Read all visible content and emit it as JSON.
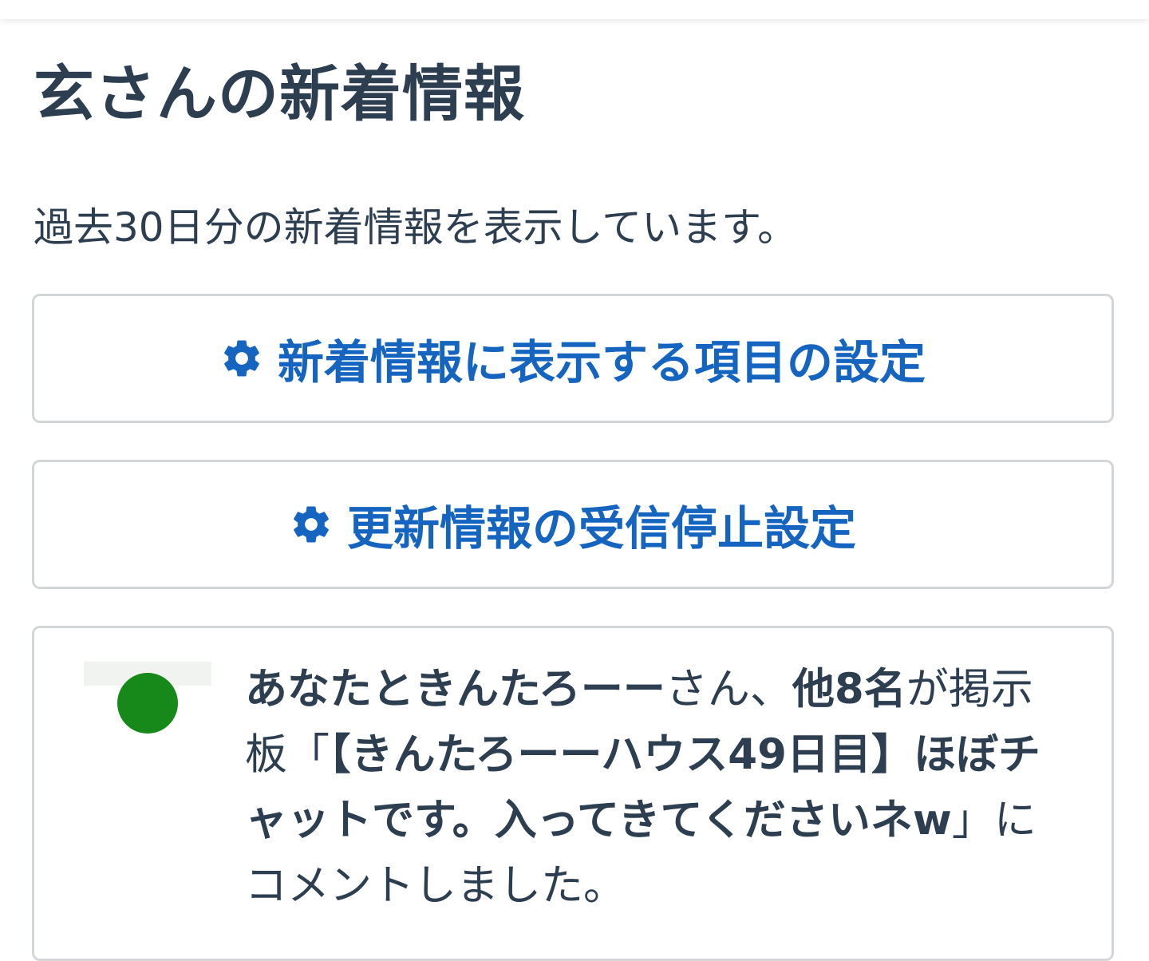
{
  "page": {
    "title": "玄さんの新着情報",
    "description": "過去30日分の新着情報を表示しています。"
  },
  "buttons": {
    "display_settings": {
      "icon": "gear-icon",
      "label": "新着情報に表示する項目の設定"
    },
    "unsubscribe_settings": {
      "icon": "gear-icon",
      "label": "更新情報の受信停止設定"
    }
  },
  "notification": {
    "avatar_icon": "user-avatar",
    "parts": {
      "you_and_user": "あなたときんたろーー",
      "san": "さん、",
      "others": "他8名",
      "ga_bbs": "が掲示板「",
      "thread_title": "【きんたろーーハウス49日目】ほぼチャットです。入ってきてくださいネw",
      "commented": "」にコメントしました。"
    }
  },
  "colors": {
    "text": "#2c3e50",
    "link": "#1565c0",
    "border": "#d3d6d9",
    "avatar_green": "#16891a"
  }
}
